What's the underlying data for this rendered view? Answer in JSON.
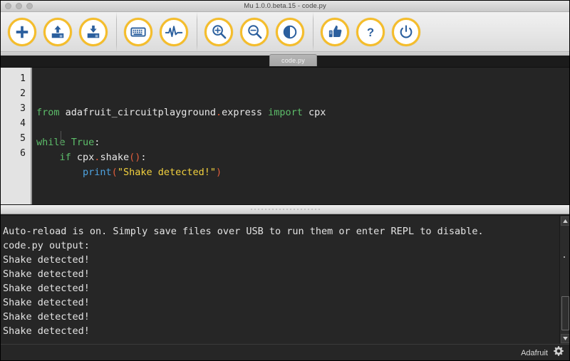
{
  "window": {
    "title": "Mu 1.0.0.beta.15 - code.py",
    "controls": [
      "close",
      "minimize",
      "zoom"
    ]
  },
  "toolbar": {
    "buttons": [
      {
        "name": "new-button",
        "icon": "plus-icon",
        "label": "New"
      },
      {
        "name": "load-button",
        "icon": "upload-icon",
        "label": "Load"
      },
      {
        "name": "save-button",
        "icon": "download-icon",
        "label": "Save"
      },
      {
        "name": "serial-button",
        "icon": "keyboard-icon",
        "label": "Serial"
      },
      {
        "name": "plotter-button",
        "icon": "waveform-icon",
        "label": "Plotter"
      },
      {
        "name": "zoom-in-button",
        "icon": "magnifier-plus-icon",
        "label": "Zoom in"
      },
      {
        "name": "zoom-out-button",
        "icon": "magnifier-minus-icon",
        "label": "Zoom out"
      },
      {
        "name": "theme-button",
        "icon": "contrast-icon",
        "label": "Theme"
      },
      {
        "name": "check-button",
        "icon": "thumbs-up-icon",
        "label": "Check"
      },
      {
        "name": "help-button",
        "icon": "question-mark-icon",
        "label": "Help"
      },
      {
        "name": "quit-button",
        "icon": "power-icon",
        "label": "Quit"
      }
    ],
    "separators_after": [
      2,
      4
    ]
  },
  "tabs": [
    {
      "label": "code.py",
      "active": true
    }
  ],
  "editor": {
    "line_numbers": [
      "1",
      "2",
      "3",
      "4",
      "5",
      "6"
    ],
    "lines": [
      [
        {
          "t": "from",
          "c": "kw"
        },
        {
          "t": " adafruit_circuitplayground",
          "c": "plain"
        },
        {
          "t": ".",
          "c": "punc"
        },
        {
          "t": "express ",
          "c": "plain"
        },
        {
          "t": "import",
          "c": "kw"
        },
        {
          "t": " cpx",
          "c": "plain"
        }
      ],
      [],
      [
        {
          "t": "while ",
          "c": "kw"
        },
        {
          "t": "True",
          "c": "kw"
        },
        {
          "t": ":",
          "c": "plain"
        }
      ],
      [
        {
          "t": "    ",
          "c": "plain"
        },
        {
          "t": "if",
          "c": "kw"
        },
        {
          "t": " cpx",
          "c": "plain"
        },
        {
          "t": ".",
          "c": "punc"
        },
        {
          "t": "shake",
          "c": "plain"
        },
        {
          "t": "()",
          "c": "punc"
        },
        {
          "t": ":",
          "c": "plain"
        }
      ],
      [
        {
          "t": "        ",
          "c": "plain"
        },
        {
          "t": "print",
          "c": "fn"
        },
        {
          "t": "(",
          "c": "punc"
        },
        {
          "t": "\"Shake detected!\"",
          "c": "str"
        },
        {
          "t": ")",
          "c": "punc"
        }
      ],
      []
    ],
    "colors": {
      "background": "#252525",
      "gutter_background": "#e3e3e3",
      "keyword": "#5dbe6a",
      "function": "#4ea3e0",
      "string": "#f3d13e",
      "punctuation": "#e05d3c",
      "text": "#e8e8e8"
    }
  },
  "console": {
    "lines": [
      "Auto-reload is on. Simply save files over USB to run them or enter REPL to disable.",
      "code.py output:",
      "Shake detected!",
      "Shake detected!",
      "Shake detected!",
      "Shake detected!",
      "Shake detected!",
      "Shake detected!"
    ],
    "background": "#262626",
    "text_color": "#e3e3e3"
  },
  "statusbar": {
    "mode_label": "Adafruit",
    "gear_icon": "gear-icon"
  },
  "theme": {
    "accent": "#f5bd2b",
    "icon_blue": "#2b5f9e"
  }
}
